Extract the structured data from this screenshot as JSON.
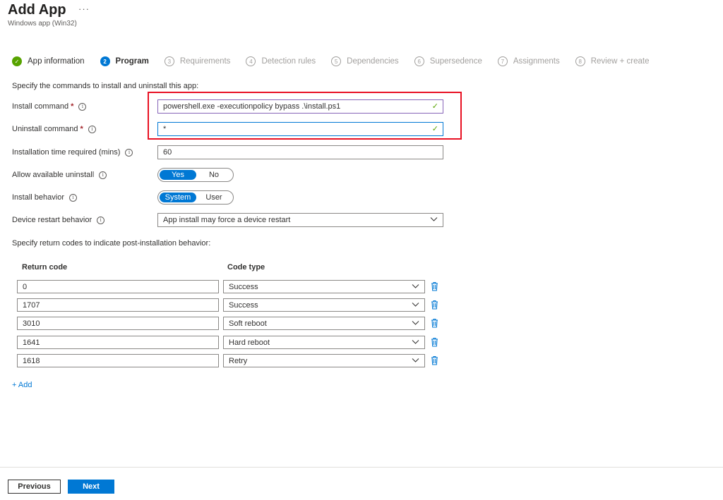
{
  "header": {
    "title": "Add App",
    "more": "···",
    "subtitle": "Windows app (Win32)"
  },
  "steps": [
    {
      "num": "✓",
      "label": "App information",
      "state": "done"
    },
    {
      "num": "2",
      "label": "Program",
      "state": "active"
    },
    {
      "num": "3",
      "label": "Requirements",
      "state": "todo"
    },
    {
      "num": "4",
      "label": "Detection rules",
      "state": "todo"
    },
    {
      "num": "5",
      "label": "Dependencies",
      "state": "todo"
    },
    {
      "num": "6",
      "label": "Supersedence",
      "state": "todo"
    },
    {
      "num": "7",
      "label": "Assignments",
      "state": "todo"
    },
    {
      "num": "8",
      "label": "Review + create",
      "state": "todo"
    }
  ],
  "form": {
    "intro": "Specify the commands to install and uninstall this app:",
    "install_label": "Install command",
    "install_value": "powershell.exe -executionpolicy bypass .\\install.ps1",
    "uninstall_label": "Uninstall command",
    "uninstall_value": "*",
    "time_label": "Installation time required (mins)",
    "time_value": "60",
    "uninstall_allow_label": "Allow available uninstall",
    "uninstall_yes": "Yes",
    "uninstall_no": "No",
    "behavior_label": "Install behavior",
    "behavior_system": "System",
    "behavior_user": "User",
    "restart_label": "Device restart behavior",
    "restart_value": "App install may force a device restart",
    "required_mark": "*",
    "info_glyph": "i"
  },
  "return_codes": {
    "intro": "Specify return codes to indicate post-installation behavior:",
    "col_code": "Return code",
    "col_type": "Code type",
    "rows": [
      {
        "code": "0",
        "type": "Success"
      },
      {
        "code": "1707",
        "type": "Success"
      },
      {
        "code": "3010",
        "type": "Soft reboot"
      },
      {
        "code": "1641",
        "type": "Hard reboot"
      },
      {
        "code": "1618",
        "type": "Retry"
      }
    ],
    "add_label": "+ Add"
  },
  "footer": {
    "previous": "Previous",
    "next": "Next"
  },
  "colors": {
    "accent": "#0078d4",
    "success": "#57a300",
    "highlight": "#e81123",
    "required": "#a4262c"
  },
  "icons": {
    "check": "checkmark-icon",
    "chevron": "chevron-down-icon",
    "info": "info-icon",
    "delete": "trash-icon"
  }
}
